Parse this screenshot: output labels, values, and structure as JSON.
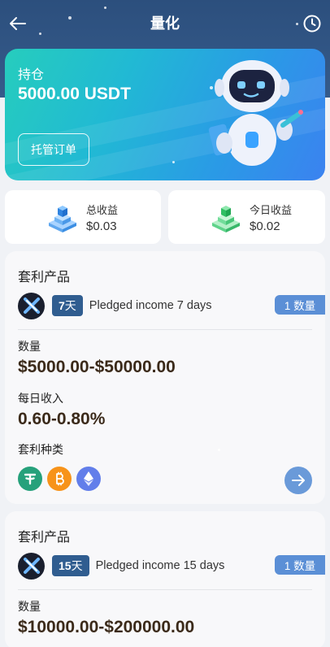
{
  "header": {
    "title": "量化",
    "back_icon": "arrow-left-icon",
    "history_icon": "clock-icon"
  },
  "holding": {
    "label": "持仓",
    "amount": "5000.00 USDT",
    "button_label": "托管订单"
  },
  "stats": [
    {
      "label": "总收益",
      "value": "$0.03",
      "icon": "blue-cube-stack-icon"
    },
    {
      "label": "今日收益",
      "value": "$0.02",
      "icon": "green-cube-stack-icon"
    }
  ],
  "products": [
    {
      "title": "套利产品",
      "days_num": "7",
      "days_unit": "天",
      "description": "Pledged income 7 days",
      "quantity_badge": "1 数量",
      "amount_label": "数量",
      "amount_range": "$5000.00-$50000.00",
      "daily_label": "每日收入",
      "daily_range": "0.60-0.80%",
      "types_label": "套利种类",
      "coins": [
        "USDT",
        "BTC",
        "ETH"
      ]
    },
    {
      "title": "套利产品",
      "days_num": "15",
      "days_unit": "天",
      "description": "Pledged income 15 days",
      "quantity_badge": "1 数量",
      "amount_label": "数量",
      "amount_range": "$10000.00-$200000.00"
    }
  ],
  "colors": {
    "header_bg": "#2c4f7d",
    "days_badge": "#305d90",
    "quantity_badge": "#5b8fd6",
    "usdt": "#26a17b",
    "btc": "#f7931a",
    "eth": "#627eea"
  }
}
